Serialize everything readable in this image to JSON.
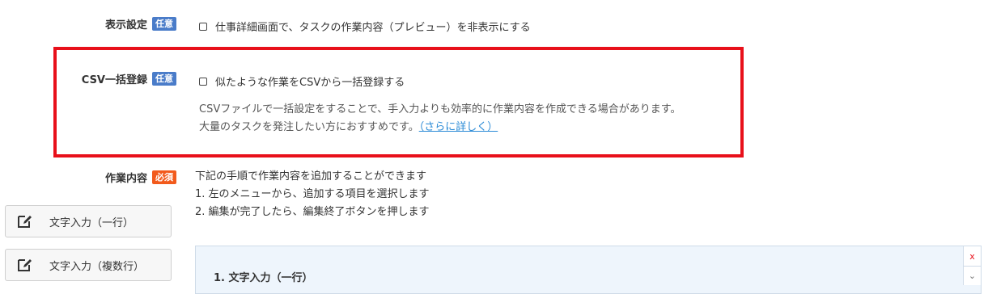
{
  "display_setting": {
    "label": "表示設定",
    "badge": "任意",
    "checkbox_label": "仕事詳細画面で、タスクの作業内容（プレビュー）を非表示にする"
  },
  "csv_bulk": {
    "label": "CSV一括登録",
    "badge": "任意",
    "checkbox_label": "似たような作業をCSVから一括登録する",
    "description_line1": "CSVファイルで一括設定をすることで、手入力よりも効率的に作業内容を作成できる場合があります。",
    "description_line2": "大量のタスクを発注したい方におすすめです。",
    "more_link": "（さらに詳しく）"
  },
  "work_content": {
    "label": "作業内容",
    "badge": "必須",
    "instructions": [
      "下記の手順で作業内容を追加することができます",
      "1. 左のメニューから、追加する項目を選択します",
      "2. 編集が完了したら、編集終了ボタンを押します"
    ]
  },
  "side_menu": {
    "items": [
      {
        "label": "文字入力（一行）",
        "icon": "edit-icon"
      },
      {
        "label": "文字入力（複数行）",
        "icon": "edit-icon"
      }
    ]
  },
  "editor_panel": {
    "title": "1. 文字入力（一行）",
    "delete_glyph": "x",
    "collapse_glyph": "⌄"
  },
  "colors": {
    "highlight": "#e8101a",
    "badge_optional": "#4a7cc9",
    "badge_required": "#f25a1c",
    "link": "#2a8ad6"
  }
}
